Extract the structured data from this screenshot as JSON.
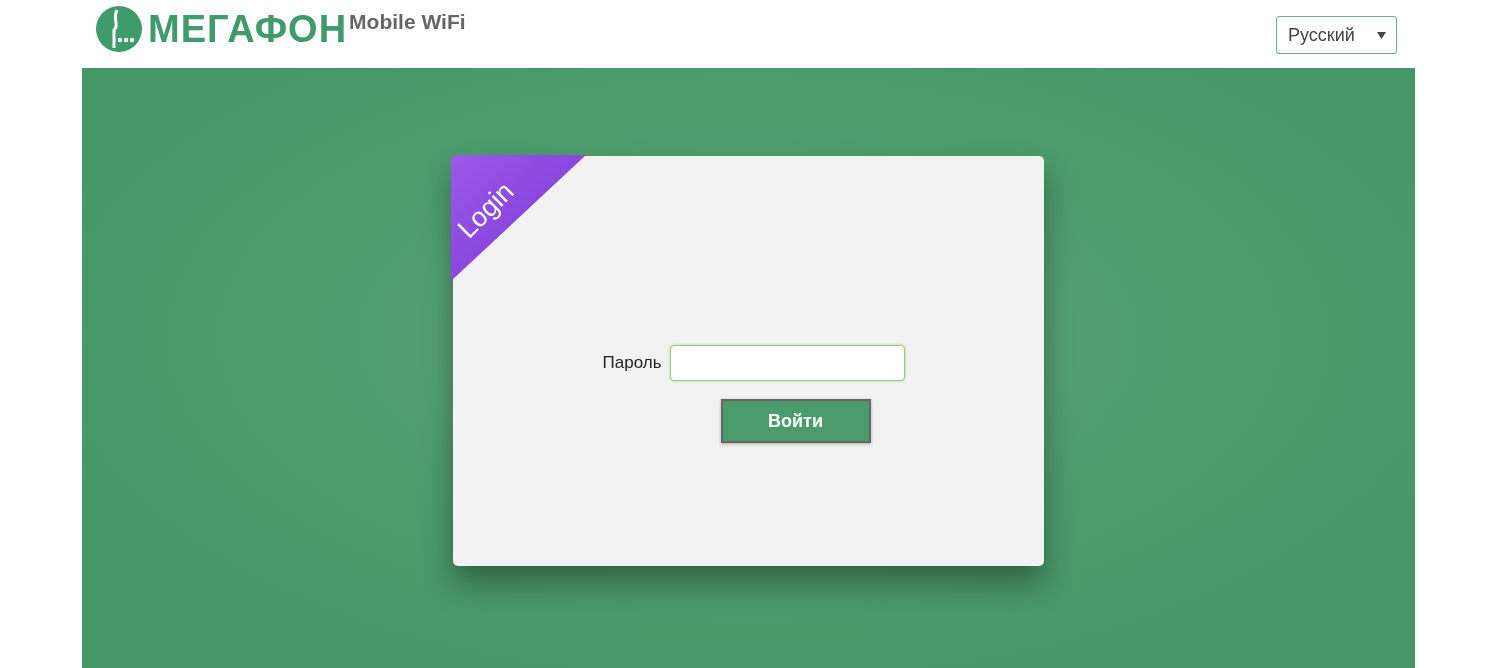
{
  "header": {
    "logo_text": "МЕГАФОН",
    "product": "Mobile WiFi",
    "language": "Русский"
  },
  "login_card": {
    "ribbon": "Login",
    "password_label": "Пароль",
    "submit": "Войти"
  }
}
